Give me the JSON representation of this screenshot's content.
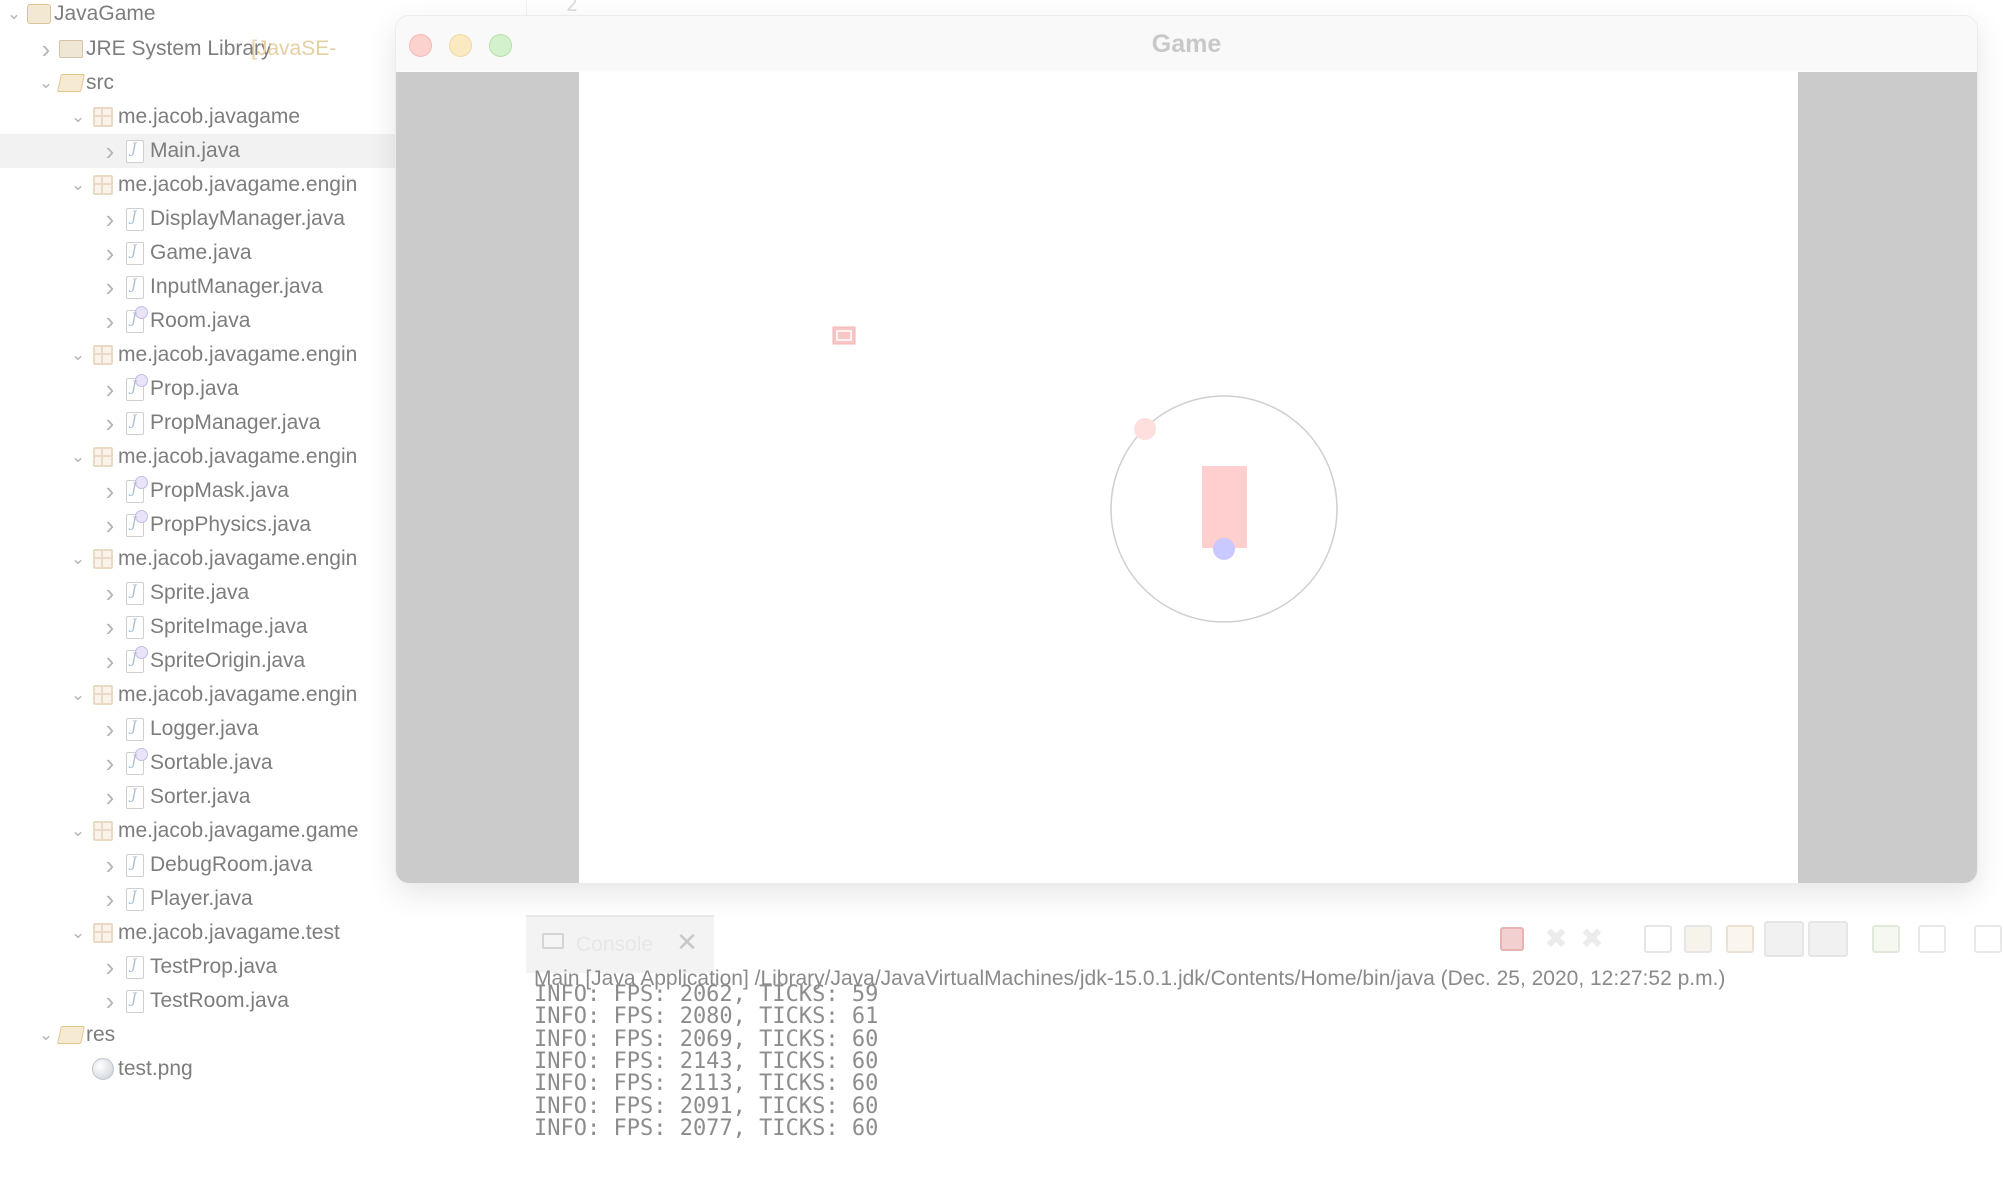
{
  "explorer": {
    "items": [
      {
        "label": "JavaGame",
        "icon": "project-icon",
        "twisty": "expanded"
      },
      {
        "label": "JRE System Library",
        "suffix": "[JavaSE-",
        "icon": "library-icon",
        "twisty": "collapsed"
      },
      {
        "label": "src",
        "icon": "source-folder-icon",
        "twisty": "expanded"
      },
      {
        "label": "me.jacob.javagame",
        "icon": "package-icon",
        "twisty": "expanded"
      },
      {
        "label": "Main.java",
        "icon": "java-file-icon",
        "twisty": "collapsed",
        "selected": true
      },
      {
        "label": "me.jacob.javagame.engin",
        "icon": "package-icon",
        "twisty": "expanded"
      },
      {
        "label": "DisplayManager.java",
        "icon": "java-file-icon",
        "twisty": "collapsed"
      },
      {
        "label": "Game.java",
        "icon": "java-file-icon",
        "twisty": "collapsed"
      },
      {
        "label": "InputManager.java",
        "icon": "java-file-icon",
        "twisty": "collapsed"
      },
      {
        "label": "Room.java",
        "icon": "abstract-java-file-icon",
        "twisty": "collapsed"
      },
      {
        "label": "me.jacob.javagame.engin",
        "icon": "package-icon",
        "twisty": "expanded"
      },
      {
        "label": "Prop.java",
        "icon": "abstract-java-file-icon",
        "twisty": "collapsed"
      },
      {
        "label": "PropManager.java",
        "icon": "java-file-icon",
        "twisty": "collapsed"
      },
      {
        "label": "me.jacob.javagame.engin",
        "icon": "package-icon",
        "twisty": "expanded"
      },
      {
        "label": "PropMask.java",
        "icon": "interface-java-file-icon",
        "twisty": "collapsed"
      },
      {
        "label": "PropPhysics.java",
        "icon": "interface-java-file-icon",
        "twisty": "collapsed"
      },
      {
        "label": "me.jacob.javagame.engin",
        "icon": "package-icon",
        "twisty": "expanded"
      },
      {
        "label": "Sprite.java",
        "icon": "java-file-icon",
        "twisty": "collapsed"
      },
      {
        "label": "SpriteImage.java",
        "icon": "java-file-icon",
        "twisty": "collapsed"
      },
      {
        "label": "SpriteOrigin.java",
        "icon": "enum-java-file-icon",
        "twisty": "collapsed"
      },
      {
        "label": "me.jacob.javagame.engin",
        "icon": "package-icon",
        "twisty": "expanded"
      },
      {
        "label": "Logger.java",
        "icon": "java-file-icon",
        "twisty": "collapsed"
      },
      {
        "label": "Sortable.java",
        "icon": "interface-java-file-icon",
        "twisty": "collapsed"
      },
      {
        "label": "Sorter.java",
        "icon": "java-file-icon",
        "twisty": "collapsed"
      },
      {
        "label": "me.jacob.javagame.game",
        "icon": "package-icon",
        "twisty": "expanded"
      },
      {
        "label": "DebugRoom.java",
        "icon": "java-file-icon",
        "twisty": "collapsed"
      },
      {
        "label": "Player.java",
        "icon": "java-file-icon",
        "twisty": "collapsed"
      },
      {
        "label": "me.jacob.javagame.test",
        "icon": "package-icon",
        "twisty": "expanded"
      },
      {
        "label": "TestProp.java",
        "icon": "java-file-icon",
        "twisty": "collapsed"
      },
      {
        "label": "TestRoom.java",
        "icon": "java-file-icon",
        "twisty": "collapsed"
      },
      {
        "label": "res",
        "icon": "folder-icon",
        "twisty": "expanded"
      },
      {
        "label": "test.png",
        "icon": "image-file-icon",
        "twisty": "none"
      }
    ]
  },
  "editor": {
    "visible_line_number": "2"
  },
  "game_window": {
    "title": "Game",
    "controls": {
      "close": "close-button",
      "minimize": "minimize-button",
      "maximize": "maximize-button"
    },
    "colors": {
      "background": "#ffffff",
      "letterbox": "#cbcbcb",
      "player_body": "#ffcfcf",
      "player_dot": "#c9c9ff",
      "orbit_dot": "#ffdede",
      "sprite": "#f8c6c6"
    }
  },
  "console": {
    "tab_label": "Console",
    "header": "Main [Java Application] /Library/Java/JavaVirtualMachines/jdk-15.0.1.jdk/Contents/Home/bin/java  (Dec. 25, 2020, 12:27:52 p.m.)",
    "lines": [
      "INFO: FPS: 2062, TICKS: 59",
      "INFO: FPS: 2080, TICKS: 61",
      "INFO: FPS: 2069, TICKS: 60",
      "INFO: FPS: 2143, TICKS: 60",
      "INFO: FPS: 2113, TICKS: 60",
      "INFO: FPS: 2091, TICKS: 60",
      "INFO: FPS: 2077, TICKS: 60"
    ],
    "toolbar": [
      "terminate-icon",
      "remove-launch-icon",
      "remove-all-icon",
      "clear-console-icon",
      "scroll-lock-icon",
      "word-wrap-icon",
      "show-on-stdout-icon",
      "show-on-stderr-icon",
      "pin-console-icon",
      "display-console-icon",
      "new-console-icon"
    ]
  }
}
